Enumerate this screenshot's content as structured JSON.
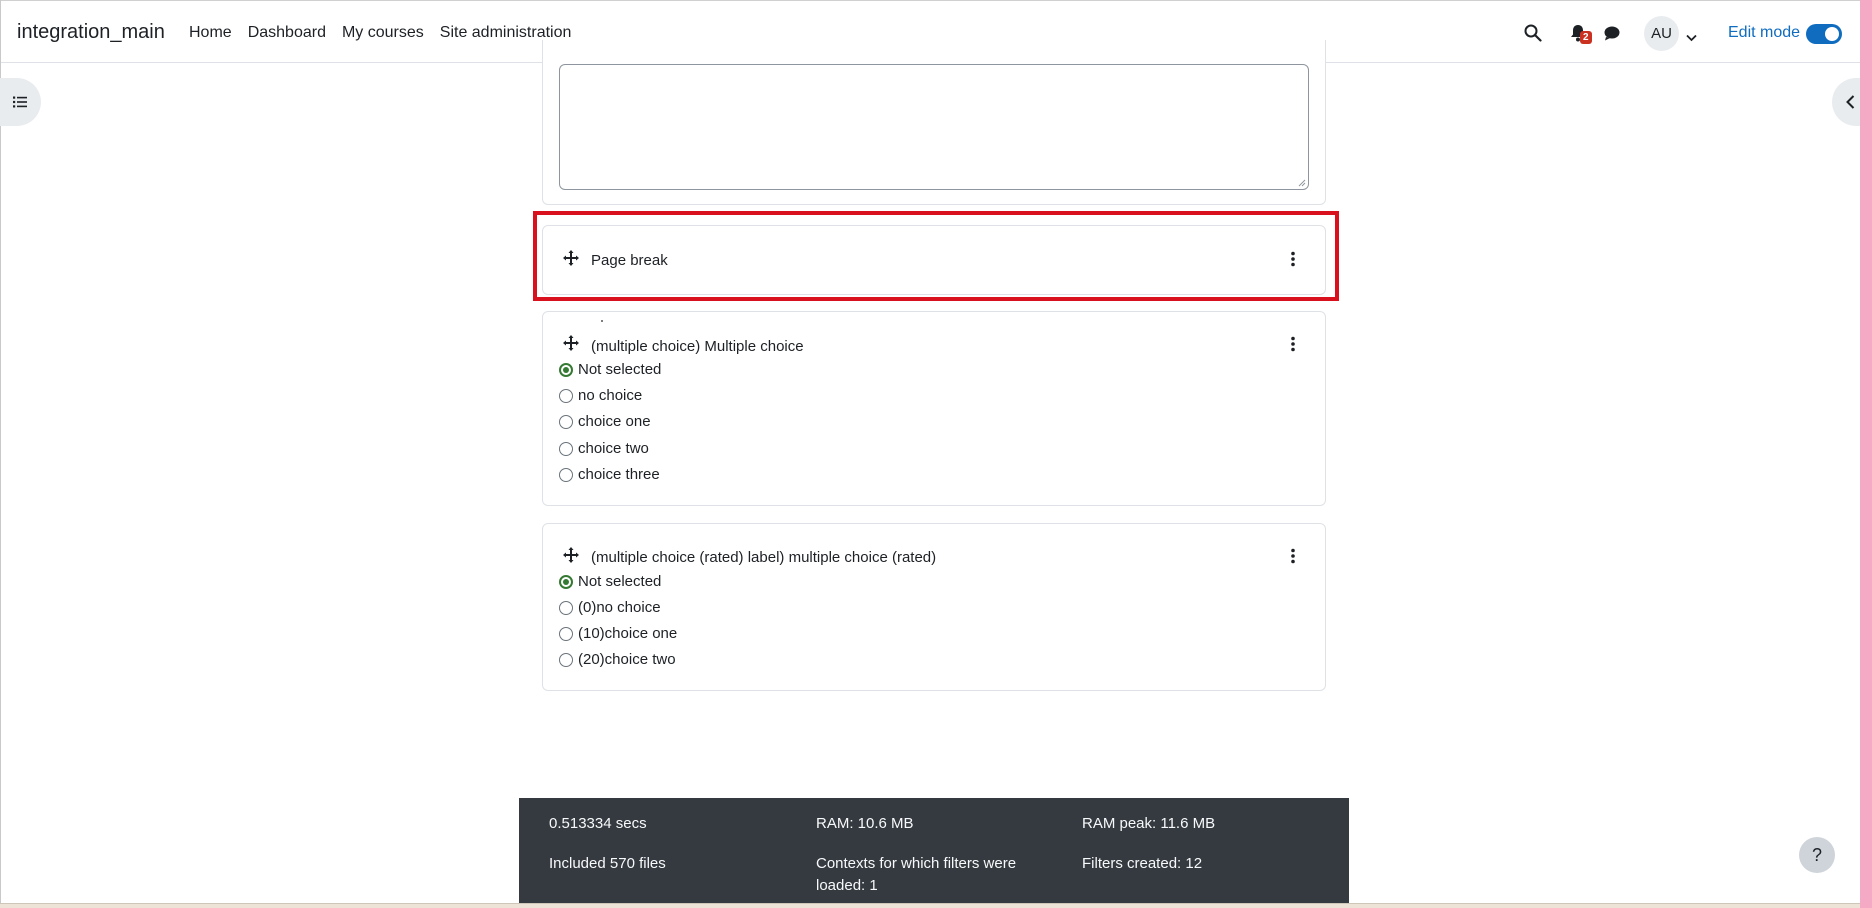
{
  "navbar": {
    "brand": "integration_main",
    "links": [
      "Home",
      "Dashboard",
      "My courses",
      "Site administration"
    ],
    "notification_count": "2",
    "avatar_initials": "AU",
    "edit_mode_label": "Edit mode",
    "edit_mode_on": true
  },
  "questions": {
    "page_break": {
      "title": "Page break"
    },
    "multiple_choice": {
      "title": "(multiple choice) Multiple choice",
      "options": [
        "Not selected",
        "no choice",
        "choice one",
        "choice two",
        "choice three"
      ],
      "selected": 0
    },
    "multiple_choice_rated": {
      "title": "(multiple choice (rated) label) multiple choice (rated)",
      "options": [
        "Not selected",
        "(0)no choice",
        "(10)choice one",
        "(20)choice two"
      ],
      "selected": 0
    }
  },
  "footer": {
    "time": "0.513334 secs",
    "ram": "RAM: 10.6 MB",
    "ram_peak": "RAM peak: 11.6 MB",
    "files": "Included 570 files",
    "contexts_line1": "Contexts for which filters were",
    "contexts_line2": "loaded: 1",
    "filters_created": "Filters created: 12"
  },
  "help": {
    "label": "?"
  },
  "colors": {
    "accent": "#0f6cbf",
    "highlight": "#d9111f",
    "footer_bg": "#343a40",
    "badge": "#ca3120",
    "radio_checked": "#357a32"
  }
}
